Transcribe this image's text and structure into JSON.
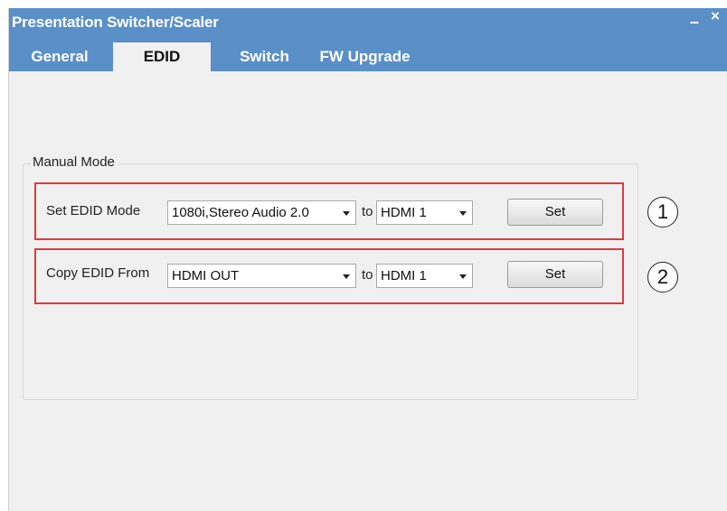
{
  "window": {
    "title": "Presentation Switcher/Scaler",
    "minimize_glyph": "–",
    "close_glyph": "×"
  },
  "tabs": [
    {
      "label": "General",
      "active": false
    },
    {
      "label": "EDID",
      "active": true
    },
    {
      "label": "Switch",
      "active": false
    },
    {
      "label": "FW Upgrade",
      "active": false
    }
  ],
  "manual_mode": {
    "group_label": "Manual Mode",
    "set_edid": {
      "label": "Set EDID Mode",
      "mode_value": "1080i,Stereo Audio 2.0",
      "to_label": "to",
      "target_value": "HDMI 1",
      "button_label": "Set",
      "callout": "1"
    },
    "copy_edid": {
      "label": "Copy EDID From",
      "source_value": "HDMI OUT",
      "to_label": "to",
      "target_value": "HDMI 1",
      "button_label": "Set",
      "callout": "2"
    }
  },
  "colors": {
    "titlebar": "#5b8fc7",
    "highlight": "#e0393e",
    "panel": "#f0f0f0"
  }
}
